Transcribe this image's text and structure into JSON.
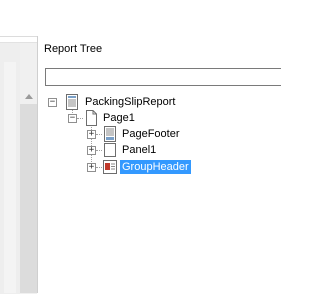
{
  "panel": {
    "title": "Report Tree",
    "search": {
      "value": "",
      "placeholder": ""
    }
  },
  "tree": {
    "root": {
      "label": "PackingSlipReport",
      "expander": "−",
      "icon": "report-icon",
      "children": [
        {
          "label": "Page1",
          "expander": "−",
          "icon": "page-icon",
          "children": [
            {
              "label": "PageFooter",
              "expander": "+",
              "icon": "page-footer-icon"
            },
            {
              "label": "Panel1",
              "expander": "+",
              "icon": "panel-icon"
            },
            {
              "label": "GroupHeader",
              "expander": "+",
              "icon": "group-header-icon",
              "selected": true
            }
          ]
        }
      ]
    }
  },
  "colors": {
    "selection": "#3399ff",
    "selection_text": "#ffffff",
    "icon_red": "#c0392b",
    "scrollbar": "#dcdcdc"
  }
}
